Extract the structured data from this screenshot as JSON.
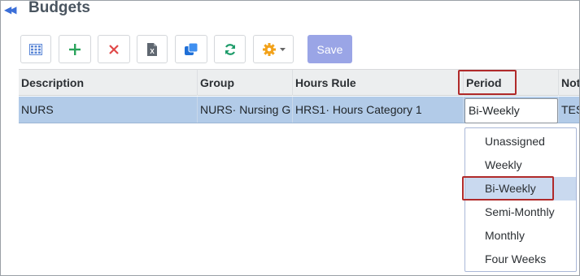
{
  "header": {
    "title": "Budgets",
    "collapse_icon": "double-chevron-left-icon"
  },
  "toolbar": {
    "buttons": [
      {
        "name": "grid-view-button",
        "icon": "grid-icon"
      },
      {
        "name": "add-button",
        "icon": "plus-icon"
      },
      {
        "name": "delete-button",
        "icon": "close-icon"
      },
      {
        "name": "export-excel-button",
        "icon": "excel-icon"
      },
      {
        "name": "copy-button",
        "icon": "copy-icon"
      },
      {
        "name": "refresh-button",
        "icon": "refresh-icon"
      },
      {
        "name": "settings-menu-button",
        "icon": "gear-icon"
      }
    ],
    "save_label": "Save"
  },
  "grid": {
    "columns": [
      "Description",
      "Group",
      "Hours Rule",
      "Period",
      "Not"
    ],
    "rows": [
      {
        "description": "NURS",
        "group": "NURS· Nursing G",
        "hours_rule": "HRS1· Hours Category 1",
        "period": "Bi-Weekly",
        "notes": "TES"
      }
    ]
  },
  "period_dropdown": {
    "options": [
      "Unassigned",
      "Weekly",
      "Bi-Weekly",
      "Semi-Monthly",
      "Monthly",
      "Four Weeks"
    ],
    "selected": "Bi-Weekly"
  },
  "colors": {
    "accent": "#3b6fd8",
    "row_selected": "#b2cbe8",
    "save_button": "#9aa5e6",
    "highlight_box": "#b02a2a"
  }
}
